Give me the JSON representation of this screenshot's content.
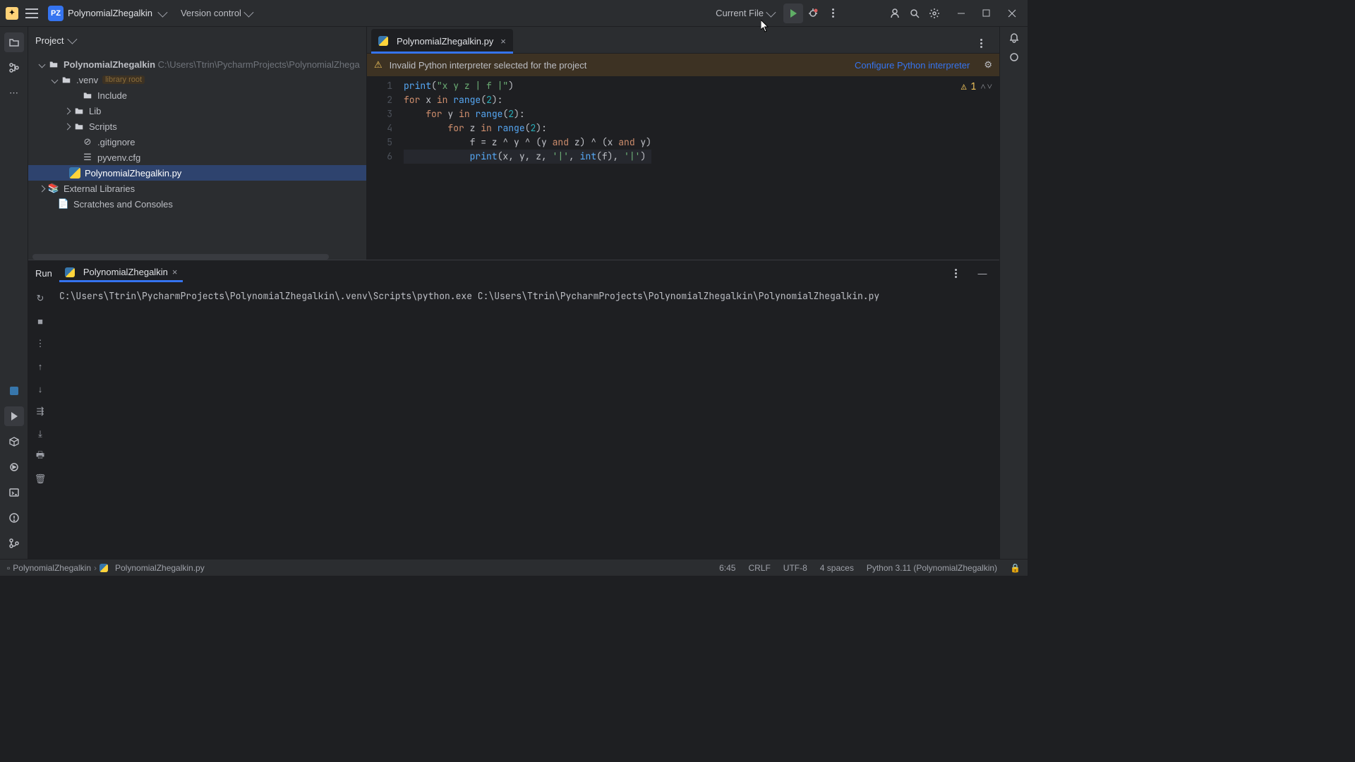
{
  "titlebar": {
    "project_badge": "PZ",
    "project_name": "PolynomialZhegalkin",
    "version_control": "Version control",
    "current_file": "Current File"
  },
  "project_panel": {
    "title": "Project",
    "root_name": "PolynomialZhegalkin",
    "root_path": "C:\\Users\\Ttrin\\PycharmProjects\\PolynomialZhega",
    "venv": ".venv",
    "library_root": "library root",
    "include": "Include",
    "lib": "Lib",
    "scripts": "Scripts",
    "gitignore": ".gitignore",
    "pyvenv": "pyvenv.cfg",
    "main_py": "PolynomialZhegalkin.py",
    "ext_lib": "External Libraries",
    "scratches": "Scratches and Consoles"
  },
  "editor": {
    "tab_name": "PolynomialZhegalkin.py",
    "warning_text": "Invalid Python interpreter selected for the project",
    "configure_link": "Configure Python interpreter",
    "inspection_count": "1",
    "code": {
      "l1_str": "\"x y z | f |\"",
      "l5_body": "            f = z ^ y ^ (y ",
      "l5_and1": "and",
      "l5_mid": " z) ^ (x ",
      "l5_and2": "and",
      "l5_end": " y)",
      "l6_args": "(x, y, z, ",
      "l6_s1": "'|'",
      "l6_m": ", ",
      "l6_int": "int",
      "l6_f": "(f), ",
      "l6_s2": "'|'",
      "l6_end": ")"
    }
  },
  "run": {
    "title": "Run",
    "config": "PolynomialZhegalkin",
    "output": "C:\\Users\\Ttrin\\PycharmProjects\\PolynomialZhegalkin\\.venv\\Scripts\\python.exe C:\\Users\\Ttrin\\PycharmProjects\\PolynomialZhegalkin\\PolynomialZhegalkin.py"
  },
  "status": {
    "bc_project": "PolynomialZhegalkin",
    "bc_file": "PolynomialZhegalkin.py",
    "cursor": "6:45",
    "line_sep": "CRLF",
    "encoding": "UTF-8",
    "indent": "4 spaces",
    "interpreter": "Python 3.11 (PolynomialZhegalkin)"
  }
}
